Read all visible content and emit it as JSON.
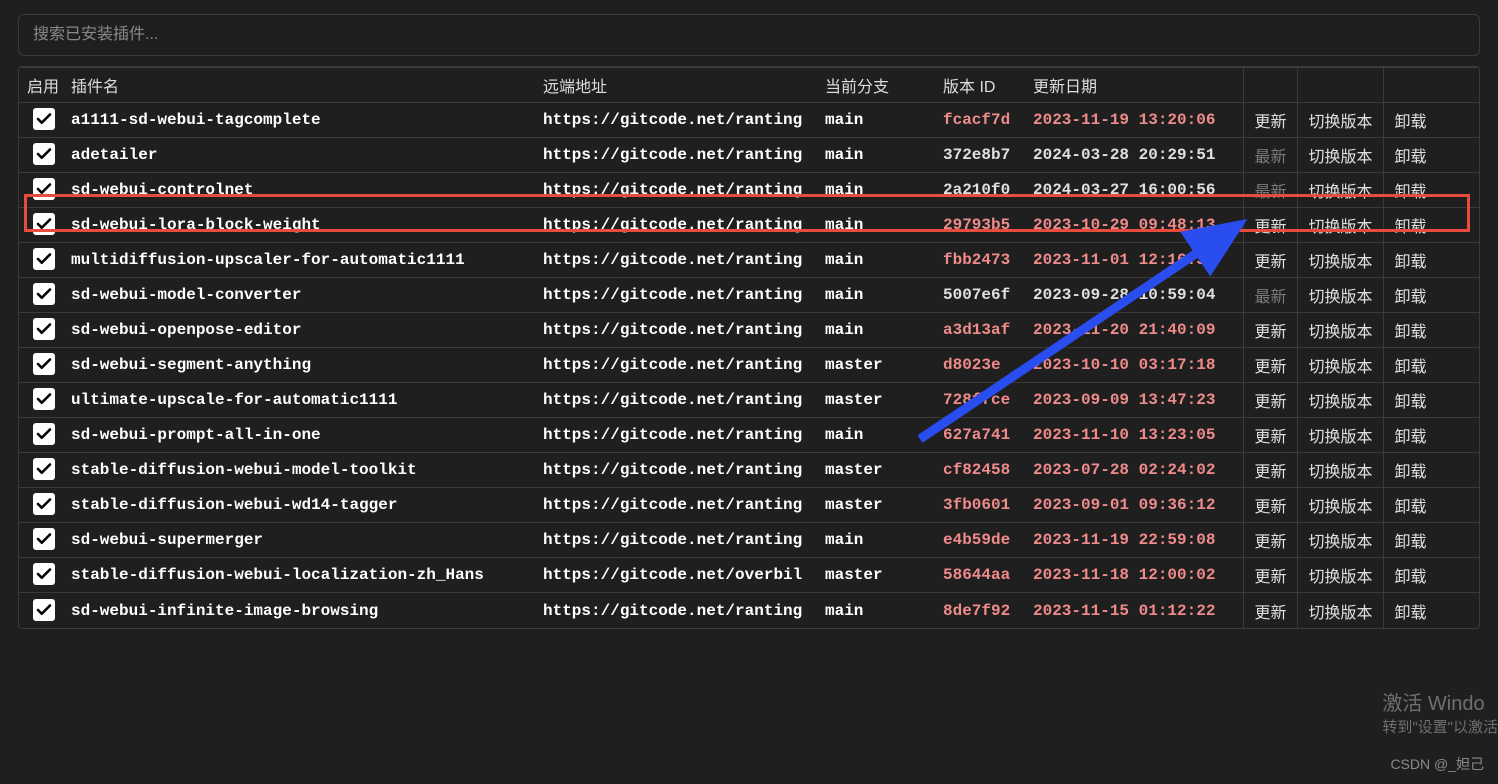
{
  "search": {
    "placeholder": "搜索已安装插件..."
  },
  "headers": {
    "enable": "启用",
    "name": "插件名",
    "remote": "远端地址",
    "branch": "当前分支",
    "version": "版本 ID",
    "date": "更新日期"
  },
  "action_labels": {
    "update": "更新",
    "latest": "最新",
    "switch": "切换版本",
    "remove": "卸载"
  },
  "rows": [
    {
      "name": "a1111-sd-webui-tagcomplete",
      "remote": "https://gitcode.net/ranting",
      "branch": "main",
      "version": "fcacf7d",
      "date": "2023-11-19 13:20:06",
      "outdated": true,
      "update_enabled": true
    },
    {
      "name": "adetailer",
      "remote": "https://gitcode.net/ranting",
      "branch": "main",
      "version": "372e8b7",
      "date": "2024-03-28 20:29:51",
      "outdated": false,
      "update_enabled": false
    },
    {
      "name": "sd-webui-controlnet",
      "remote": "https://gitcode.net/ranting",
      "branch": "main",
      "version": "2a210f0",
      "date": "2024-03-27 16:00:56",
      "outdated": false,
      "update_enabled": false
    },
    {
      "name": "sd-webui-lora-block-weight",
      "remote": "https://gitcode.net/ranting",
      "branch": "main",
      "version": "29793b5",
      "date": "2023-10-29 09:48:13",
      "outdated": true,
      "update_enabled": true
    },
    {
      "name": "multidiffusion-upscaler-for-automatic1111",
      "remote": "https://gitcode.net/ranting",
      "branch": "main",
      "version": "fbb2473",
      "date": "2023-11-01 12:16:31",
      "outdated": true,
      "update_enabled": true
    },
    {
      "name": "sd-webui-model-converter",
      "remote": "https://gitcode.net/ranting",
      "branch": "main",
      "version": "5007e6f",
      "date": "2023-09-28 10:59:04",
      "outdated": false,
      "update_enabled": false
    },
    {
      "name": "sd-webui-openpose-editor",
      "remote": "https://gitcode.net/ranting",
      "branch": "main",
      "version": "a3d13af",
      "date": "2023-11-20 21:40:09",
      "outdated": true,
      "update_enabled": true
    },
    {
      "name": "sd-webui-segment-anything",
      "remote": "https://gitcode.net/ranting",
      "branch": "master",
      "version": "d8023e",
      "date": "2023-10-10 03:17:18",
      "outdated": true,
      "update_enabled": true
    },
    {
      "name": "ultimate-upscale-for-automatic1111",
      "remote": "https://gitcode.net/ranting",
      "branch": "master",
      "version": "728ffce",
      "date": "2023-09-09 13:47:23",
      "outdated": true,
      "update_enabled": true
    },
    {
      "name": "sd-webui-prompt-all-in-one",
      "remote": "https://gitcode.net/ranting",
      "branch": "main",
      "version": "627a741",
      "date": "2023-11-10 13:23:05",
      "outdated": true,
      "update_enabled": true
    },
    {
      "name": "stable-diffusion-webui-model-toolkit",
      "remote": "https://gitcode.net/ranting",
      "branch": "master",
      "version": "cf82458",
      "date": "2023-07-28 02:24:02",
      "outdated": true,
      "update_enabled": true
    },
    {
      "name": "stable-diffusion-webui-wd14-tagger",
      "remote": "https://gitcode.net/ranting",
      "branch": "master",
      "version": "3fb0601",
      "date": "2023-09-01 09:36:12",
      "outdated": true,
      "update_enabled": true
    },
    {
      "name": "sd-webui-supermerger",
      "remote": "https://gitcode.net/ranting",
      "branch": "main",
      "version": "e4b59de",
      "date": "2023-11-19 22:59:08",
      "outdated": true,
      "update_enabled": true
    },
    {
      "name": "stable-diffusion-webui-localization-zh_Hans",
      "remote": "https://gitcode.net/overbil",
      "branch": "master",
      "version": "58644aa",
      "date": "2023-11-18 12:00:02",
      "outdated": true,
      "update_enabled": true
    },
    {
      "name": "sd-webui-infinite-image-browsing",
      "remote": "https://gitcode.net/ranting",
      "branch": "main",
      "version": "8de7f92",
      "date": "2023-11-15 01:12:22",
      "outdated": true,
      "update_enabled": true
    }
  ],
  "watermark": {
    "win_title": "激活 Windo",
    "win_sub": "转到\"设置\"以激活",
    "csdn": "CSDN @_妲己"
  }
}
